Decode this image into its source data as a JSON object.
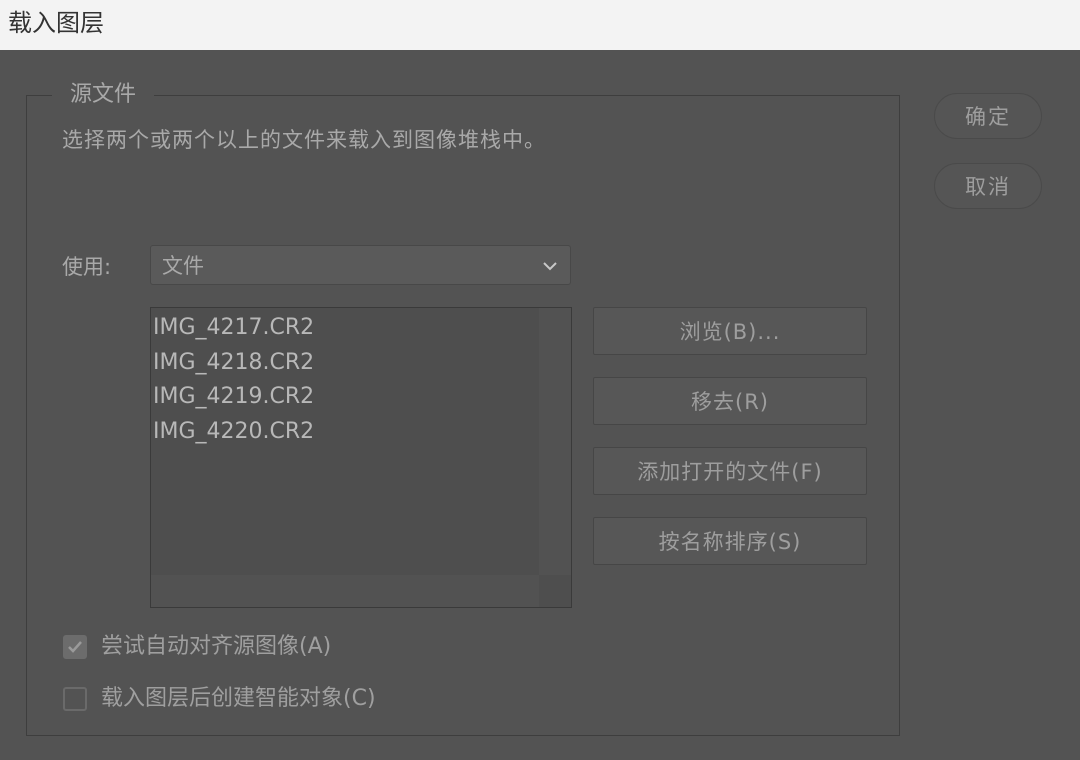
{
  "window": {
    "title": "载入图层"
  },
  "source_group": {
    "legend": "源文件",
    "description": "选择两个或两个以上的文件来载入到图像堆栈中。",
    "use_label": "使用:",
    "use_value": "文件",
    "files": [
      "IMG_4217.CR2",
      "IMG_4218.CR2",
      "IMG_4219.CR2",
      "IMG_4220.CR2"
    ],
    "buttons": {
      "browse": "浏览(B)...",
      "remove": "移去(R)",
      "add_open": "添加打开的文件(F)",
      "sort_by_name": "按名称排序(S)"
    },
    "options": {
      "auto_align": {
        "label": "尝试自动对齐源图像(A)",
        "checked": true
      },
      "smart_object": {
        "label": "载入图层后创建智能对象(C)",
        "checked": false
      }
    }
  },
  "actions": {
    "ok": "确定",
    "cancel": "取消"
  },
  "icons": {
    "dropdown": "chevron-down-icon",
    "check": "checkmark-icon"
  }
}
